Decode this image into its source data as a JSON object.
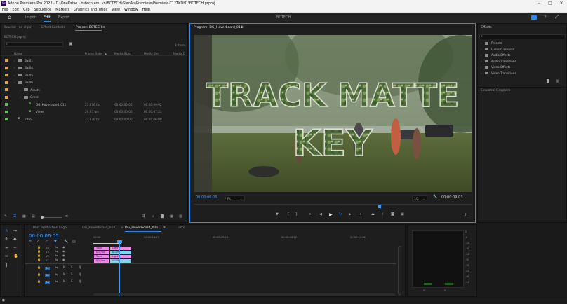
{
  "window": {
    "title": "Adobe Premiere Pro 2023 - D:\\OneDrive - bstech.edu.vn\\BCTECH\\GiaoAn\\Premiere\\Premiere-T12TKDH1\\BCTECH.prproj",
    "app_icon": "Pr"
  },
  "menu": [
    "File",
    "Edit",
    "Clip",
    "Sequence",
    "Markers",
    "Graphics and Titles",
    "View",
    "Window",
    "Help"
  ],
  "workspace": {
    "tabs": [
      "Import",
      "Edit",
      "Export"
    ],
    "active": "Edit",
    "center_title": "BCTECH"
  },
  "project_panel": {
    "tabs": [
      "Source: (no clips)",
      "Effect Controls",
      "Project: BCTECH"
    ],
    "project_file": "BCTECH.prproj",
    "item_count": "8 Items",
    "columns": [
      "Name",
      "Frame Rate",
      "Media Start",
      "Media End",
      "Media D"
    ],
    "rows": [
      {
        "name": "Bai01",
        "type": "folder",
        "color": "#e8a33a",
        "indent": 0,
        "frame_rate": "",
        "start": "",
        "end": ""
      },
      {
        "name": "Bai04",
        "type": "folder",
        "color": "#e8a33a",
        "indent": 0,
        "frame_rate": "",
        "start": "",
        "end": ""
      },
      {
        "name": "Bai05",
        "type": "folder",
        "color": "#e8a33a",
        "indent": 0,
        "frame_rate": "",
        "start": "",
        "end": ""
      },
      {
        "name": "Bai06",
        "type": "folder",
        "color": "#e8a33a",
        "indent": 0,
        "frame_rate": "",
        "start": "",
        "end": ""
      },
      {
        "name": "Assets",
        "type": "folder",
        "color": "#e8a33a",
        "indent": 1,
        "frame_rate": "",
        "start": "",
        "end": ""
      },
      {
        "name": "Green",
        "type": "folder",
        "color": "#e8a33a",
        "indent": 1,
        "frame_rate": "",
        "start": "",
        "end": ""
      },
      {
        "name": "DG_Hoverboard_011",
        "type": "sequence",
        "color": "#5fbf5f",
        "indent": 2,
        "frame_rate": "23.976 fps",
        "start": "00:00:00:00",
        "end": "00:00:09:02"
      },
      {
        "name": "Views",
        "type": "sequence",
        "color": "#5fbf5f",
        "indent": 2,
        "frame_rate": "29.97 fps",
        "start": "00:00:00:00",
        "end": "00:00:07:23"
      },
      {
        "name": "Intro",
        "type": "sequence",
        "color": "#5fbf5f",
        "indent": 0,
        "frame_rate": "23.976 fps",
        "start": "00:00:00:00",
        "end": "00:00:06:09"
      }
    ]
  },
  "program_monitor": {
    "tab": "Program: DG_Hoverboard_011",
    "overlay_line1": "TRACK MATTE",
    "overlay_line2": "KEY",
    "timecode_current": "00:00:06:05",
    "fit": "Fit",
    "quality": "1/2",
    "timecode_duration": "00:00:09:03",
    "playhead_fraction": 0.67
  },
  "effects_panel": {
    "tab": "Effects",
    "items": [
      "Presets",
      "Lumetri Presets",
      "Audio Effects",
      "Audio Transitions",
      "Video Effects",
      "Video Transitions"
    ],
    "section": "Essential Graphics"
  },
  "timeline": {
    "tabs": [
      "Post Production Logo",
      "DG_Hoverboard_007",
      "DG_Hoverboard_011",
      "Intro"
    ],
    "active": "DG_Hoverboard_011",
    "timecode": "00:00:06:05",
    "ruler": [
      "00:00",
      "00:00:14:23",
      "00:00:29:23",
      "00:00:44:22",
      "00:00:59:22"
    ],
    "video_tracks": [
      {
        "label": "V4",
        "clips": [
          "Track",
          "Light"
        ]
      },
      {
        "label": "V3",
        "clips": [
          "DG_Hov",
          "AGGR"
        ]
      },
      {
        "label": "V2",
        "clips": [
          "Track",
          "Light"
        ]
      },
      {
        "label": "V1",
        "clips": [
          "DG_Hov",
          "AGGR"
        ]
      }
    ],
    "audio_tracks": [
      "A1",
      "A2",
      "A3"
    ],
    "audio_meter_scale": [
      "0",
      "-6",
      "-12",
      "-18",
      "-24",
      "-30",
      "-36",
      "-42",
      "-48",
      "-54"
    ],
    "meter_lr": [
      "S",
      "S"
    ]
  },
  "colors": {
    "accent": "#2d8ceb",
    "timecode": "#3d9bff",
    "clip_pink": "#e88ce8",
    "clip_cyan": "#7fd8e8",
    "folder_orange": "#e8a33a",
    "seq_green": "#5fbf5f"
  }
}
